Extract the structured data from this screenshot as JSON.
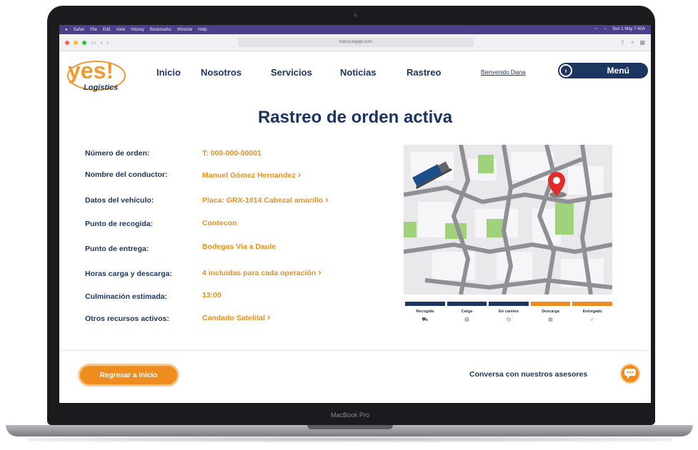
{
  "device": {
    "label": "MacBook Pro"
  },
  "mac_menubar": {
    "items": [
      "Safari",
      "File",
      "Edit",
      "View",
      "History",
      "Bookmarks",
      "Window",
      "Help"
    ],
    "clock": "Sun 1 May 7:40A"
  },
  "browser": {
    "url": "transcargaje.com"
  },
  "site": {
    "logo_text": "yes!",
    "logo_sub": "Logistics",
    "nav": [
      "Inicio",
      "Nosotros",
      "Servicios",
      "Noticias",
      "Rastreo"
    ],
    "welcome": "Bienvenido Diana",
    "menu_label": "Menú"
  },
  "page": {
    "title": "Rastreo de orden activa",
    "rows": [
      {
        "label": "Número de orden:",
        "value": "T: 000-000-00001",
        "arrow": false
      },
      {
        "label": "Nombre del conductor:",
        "value": "Manuel Gómez Hernandez",
        "arrow": true
      },
      {
        "label": "Datos del vehículo:",
        "value": "Placa: GRX-1014 Cabezal amarillo",
        "arrow": true
      },
      {
        "label": "Punto de recogida:",
        "value": "Contecon",
        "arrow": false
      },
      {
        "label": "Punto de entrega:",
        "value": "Bodegas Via a Daule",
        "arrow": false
      },
      {
        "label": "Horas carga y descarga:",
        "value": "4 incluidas para cada operación",
        "arrow": true
      },
      {
        "label": "Culminación estimada:",
        "value": "13:00",
        "arrow": false
      },
      {
        "label": "Otros recursos activos:",
        "value": "Candado Satelital",
        "arrow": true
      }
    ],
    "steps": [
      {
        "label": "Recogida",
        "color": "#1c3660"
      },
      {
        "label": "Carga",
        "color": "#1c3660"
      },
      {
        "label": "En camino",
        "color": "#1c3660"
      },
      {
        "label": "Descarga",
        "color": "#ee8c1f"
      },
      {
        "label": "Entregado",
        "color": "#ee8c1f"
      }
    ],
    "back_button": "Regresar a Inicio",
    "chat_text": "Conversa con nuestros asesores"
  },
  "colors": {
    "navy": "#1c3660",
    "orange": "#ee8c1f",
    "map_green": "#9fd27a"
  }
}
